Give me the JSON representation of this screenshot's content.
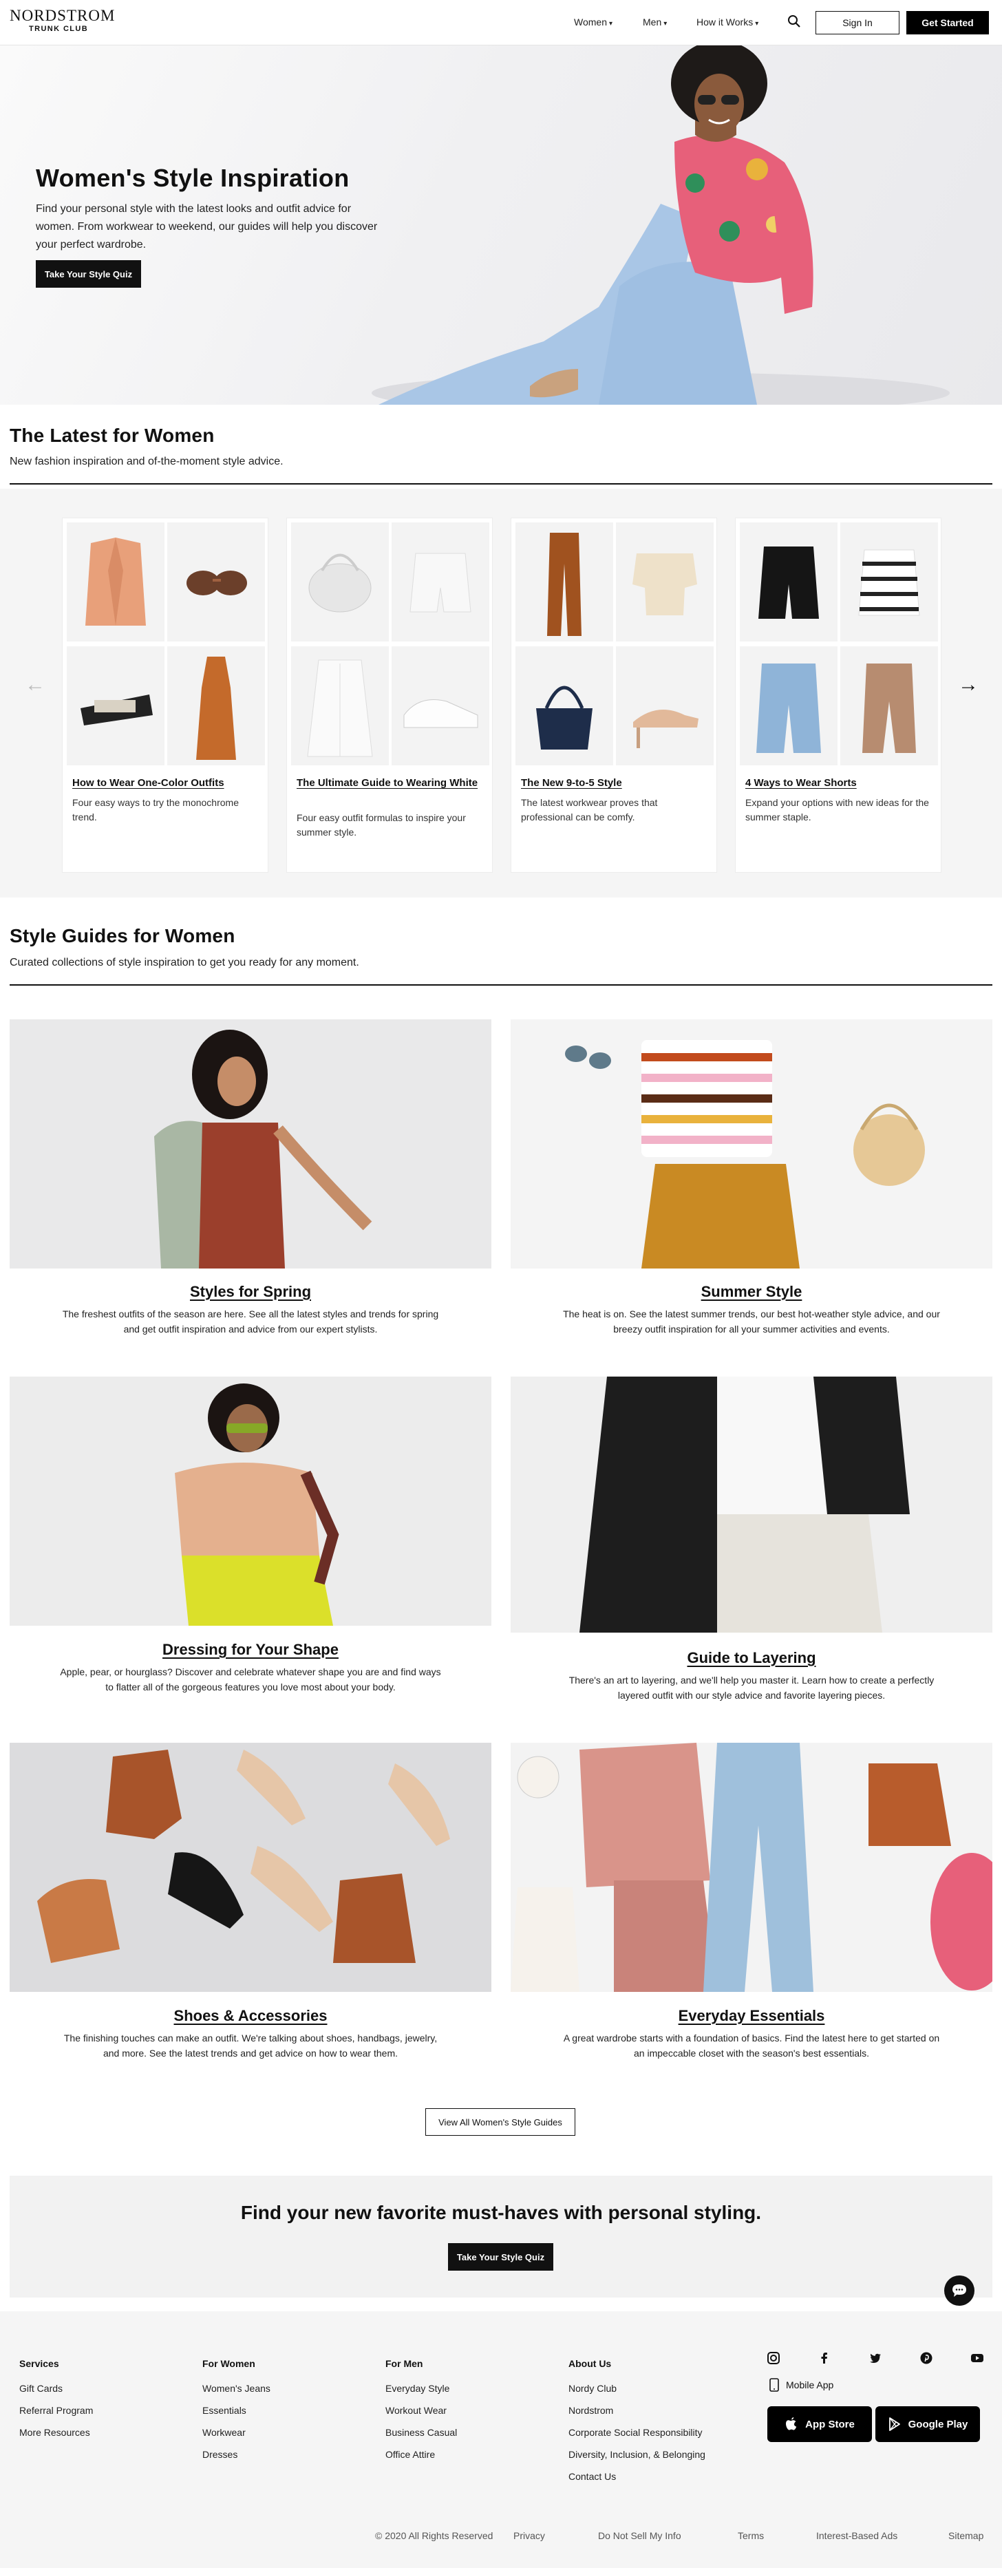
{
  "header": {
    "logo_main": "NORDSTROM",
    "logo_sub": "TRUNK CLUB",
    "nav": [
      {
        "label": "Women"
      },
      {
        "label": "Men"
      },
      {
        "label": "How it Works"
      }
    ],
    "search_icon": "search-icon",
    "sign_in": "Sign In",
    "get_started": "Get Started"
  },
  "hero": {
    "title": "Women's Style Inspiration",
    "text": "Find your personal style with the latest looks and outfit advice for women. From workwear to weekend, our guides will help you discover your perfect wardrobe.",
    "cta": "Take Your Style Quiz"
  },
  "latest": {
    "title": "The Latest for Women",
    "subtitle": "New fashion inspiration and of-the-moment style advice.",
    "cards": [
      {
        "title": "How to Wear One-Color Outfits",
        "desc": "Four easy ways to try the monochrome trend."
      },
      {
        "title": "The Ultimate Guide to Wearing White",
        "desc": "Four easy outfit formulas to inspire your summer style."
      },
      {
        "title": "The New 9-to-5 Style",
        "desc": "The latest workwear proves that professional can be comfy."
      },
      {
        "title": "4 Ways to Wear Shorts",
        "desc": "Expand your options with new ideas for the summer staple."
      }
    ],
    "prev_icon": "arrow-left-icon",
    "next_icon": "arrow-right-icon"
  },
  "guides": {
    "title": "Style Guides for Women",
    "subtitle": "Curated collections of style inspiration to get you ready for any moment.",
    "items": [
      {
        "title": "Styles for Spring",
        "desc": "The freshest outfits of the season are here. See all the latest styles and trends for spring and get outfit inspiration and advice from our expert stylists."
      },
      {
        "title": "Summer Style",
        "desc": "The heat is on. See the latest summer trends, our best hot-weather style advice, and our breezy outfit inspiration for all your summer activities and events."
      },
      {
        "title": "Dressing for Your Shape",
        "desc": "Apple, pear, or hourglass? Discover and celebrate whatever shape you are and find ways to flatter all of the gorgeous features you love most about your body."
      },
      {
        "title": "Guide to Layering",
        "desc": "There's an art to layering, and we'll help you master it. Learn how to create a perfectly layered outfit with our style advice and favorite layering pieces."
      },
      {
        "title": "Shoes & Accessories",
        "desc": "The finishing touches can make an outfit. We're talking about shoes, handbags, jewelry, and more. See the latest trends and get advice on how to wear them."
      },
      {
        "title": "Everyday Essentials",
        "desc": "A great wardrobe starts with a foundation of basics. Find the latest here to get started on an impeccable closet with the season's best essentials."
      }
    ],
    "view_all": "View All Women's Style Guides"
  },
  "promo": {
    "title": "Find your new favorite must-haves with personal styling.",
    "cta": "Take Your Style Quiz"
  },
  "footer": {
    "columns": [
      {
        "heading": "Services",
        "links": [
          "Gift Cards",
          "Referral Program",
          "More Resources"
        ]
      },
      {
        "heading": "For Women",
        "links": [
          "Women's Jeans",
          "Essentials",
          "Workwear",
          "Dresses"
        ]
      },
      {
        "heading": "For Men",
        "links": [
          "Everyday Style",
          "Workout Wear",
          "Business Casual",
          "Office Attire"
        ]
      },
      {
        "heading": "About Us",
        "links": [
          "Nordy Club",
          "Nordstrom",
          "Corporate Social Responsibility",
          "Diversity, Inclusion, & Belonging",
          "Contact Us"
        ]
      }
    ],
    "social_icons": [
      "instagram-icon",
      "facebook-icon",
      "twitter-icon",
      "pinterest-icon",
      "youtube-icon"
    ],
    "mobile_app": "Mobile App",
    "app_store": "App Store",
    "google_play": "Google Play",
    "copyright": "© 2020 All Rights Reserved",
    "legal": [
      "Privacy",
      "Do Not Sell My Info",
      "Terms",
      "Interest-Based Ads"
    ],
    "sitemap": "Sitemap"
  },
  "colors": {
    "brand": "#000000",
    "background_gray": "#f5f5f5",
    "text": "#111111"
  }
}
